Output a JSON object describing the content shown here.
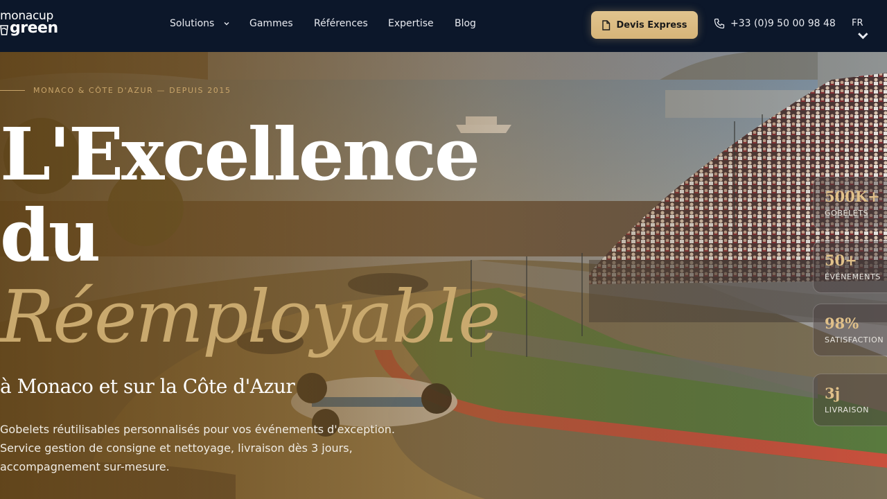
{
  "brand": {
    "line1": "monacup",
    "line2": "green"
  },
  "nav": {
    "items": [
      {
        "label": "Solutions",
        "dropdown": true
      },
      {
        "label": "Gammes"
      },
      {
        "label": "Références"
      },
      {
        "label": "Expertise"
      },
      {
        "label": "Blog"
      }
    ],
    "cta_label": "Devis Express",
    "phone": "+33 (0)9 50 00 98 48",
    "lang": "FR"
  },
  "hero": {
    "overline": "MONACO & CÔTE D'AZUR — DEPUIS 2015",
    "title_line1": "L'Excellence",
    "title_line2": "du",
    "title_line3": "Réemployable",
    "subtitle": "à Monaco et sur la Côte d'Azur",
    "description": "Gobelets réutilisables personnalisés pour vos événements d'exception. Service gestion de consigne et nettoyage, livraison dès 3 jours, accompagnement sur-mesure."
  },
  "stats": [
    {
      "value": "500K+",
      "label": "GOBELETS"
    },
    {
      "value": "50+",
      "label": "ÉVÉNEMENTS"
    },
    {
      "value": "98%",
      "label": "SATISFACTION"
    },
    {
      "value": "3j",
      "label": "LIVRAISON"
    }
  ],
  "colors": {
    "nav_bg": "#0c172a",
    "gold": "#c9a96e",
    "cta": "#d9b97f"
  }
}
